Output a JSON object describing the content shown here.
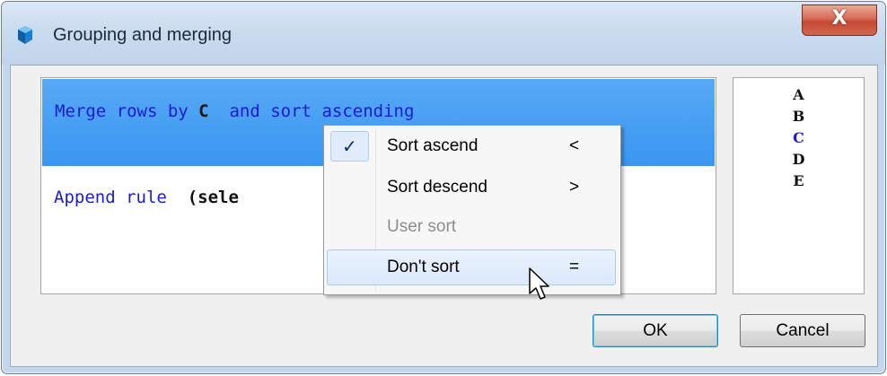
{
  "window": {
    "title": "Grouping and merging",
    "close_label": "X"
  },
  "rules": {
    "selected_rule": {
      "prefix": "Merge rows by ",
      "column": "C",
      "suffix": "  and sort ascending"
    },
    "append_rule": {
      "label": "Append rule  ",
      "hint": "(sele"
    }
  },
  "columns": [
    "A",
    "B",
    "C",
    "D",
    "E"
  ],
  "active_column": "C",
  "context_menu": {
    "items": [
      {
        "label": "Sort ascend",
        "shortcut": "<",
        "checked": true,
        "enabled": true
      },
      {
        "label": "Sort descend",
        "shortcut": ">",
        "checked": false,
        "enabled": true
      },
      {
        "label": "User sort",
        "shortcut": "",
        "checked": false,
        "enabled": false
      },
      {
        "label": "Don't sort",
        "shortcut": "=",
        "checked": false,
        "enabled": true,
        "hovered": true
      }
    ],
    "check_glyph": "✓"
  },
  "buttons": {
    "ok": "OK",
    "cancel": "Cancel"
  },
  "colors": {
    "selection": "#3a96f1",
    "rule_text": "#1b1bd6",
    "close_button": "#c64a33"
  }
}
